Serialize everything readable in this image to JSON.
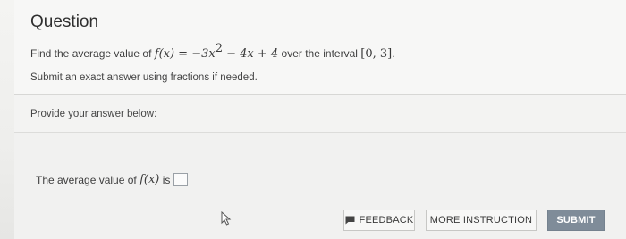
{
  "question": {
    "title": "Question",
    "prompt_before": "Find the average value of",
    "function_lhs": "f(x) = ",
    "function_rhs_a": "−3x",
    "function_exp": "2",
    "function_rhs_b": " − 4x + 4",
    "prompt_middle": "over the interval",
    "interval": "[0, 3]",
    "prompt_end": ".",
    "instruction": "Submit an exact answer using fractions if needed."
  },
  "answer": {
    "provide_label": "Provide your answer below:",
    "line_before": "The average value of",
    "line_math": "f(x)",
    "line_after": "is",
    "input_value": ""
  },
  "buttons": {
    "feedback_label": "FEEDBACK",
    "more_instruction_label": "MORE INSTRUCTION",
    "submit_label": "SUBMIT"
  },
  "colors": {
    "submit_bg": "#7f8c99",
    "page_bg": "#f4f4f2"
  },
  "icons": {
    "feedback": "feedback-flag-icon",
    "cursor": "mouse-pointer-icon"
  }
}
